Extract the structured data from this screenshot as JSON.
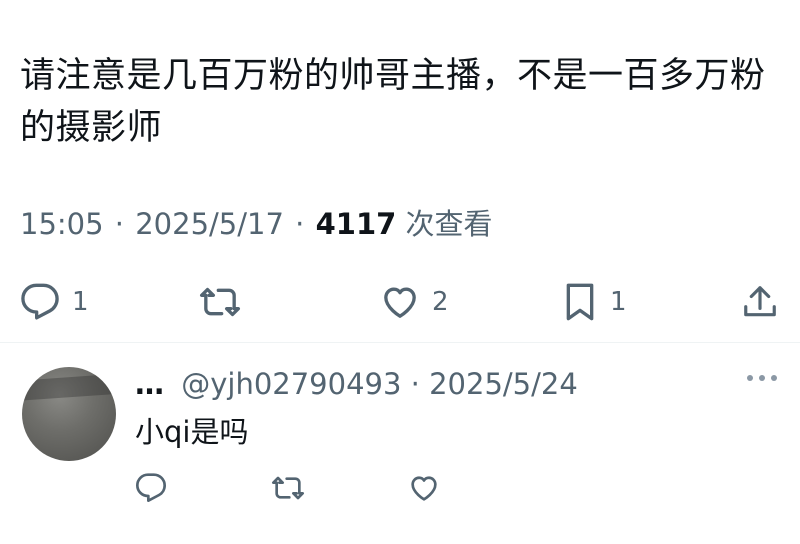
{
  "tweet": {
    "text": "请注意是几百万粉的帅哥主播，不是一百多万粉的摄影师",
    "time": "15:05",
    "date": "2025/5/17",
    "views_count": "4117",
    "views_label": "次查看"
  },
  "actions": {
    "reply_count": "1",
    "like_count": "2",
    "bookmark_count": "1"
  },
  "reply": {
    "name": "…",
    "handle": "@yjh02790493",
    "separator": "·",
    "date": "2025/5/24",
    "text": "小qi是吗"
  },
  "icons": [
    "reply-icon",
    "retweet-icon",
    "like-icon",
    "bookmark-icon",
    "share-icon",
    "more-icon"
  ],
  "colors": {
    "text_primary": "#0f1419",
    "text_secondary": "#536471",
    "divider": "#eff3f4"
  }
}
